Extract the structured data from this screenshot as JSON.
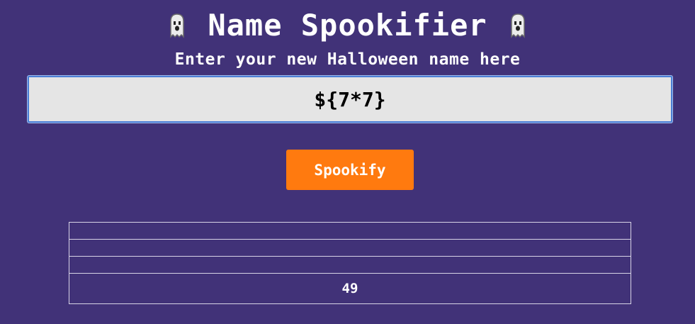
{
  "header": {
    "title": "Name Spookifier",
    "left_icon": "ghost-icon",
    "right_icon": "ghost-icon",
    "subtitle": "Enter your new Halloween name here"
  },
  "form": {
    "name_value": "${7*7}",
    "submit_label": "Spookify"
  },
  "results": {
    "rows": [
      "",
      "",
      "",
      "49"
    ]
  },
  "colors": {
    "background": "#413278",
    "input_bg": "#e5e5e5",
    "input_border": "#4a7fd6",
    "button": "#ff7a0f",
    "text": "#ffffff"
  }
}
